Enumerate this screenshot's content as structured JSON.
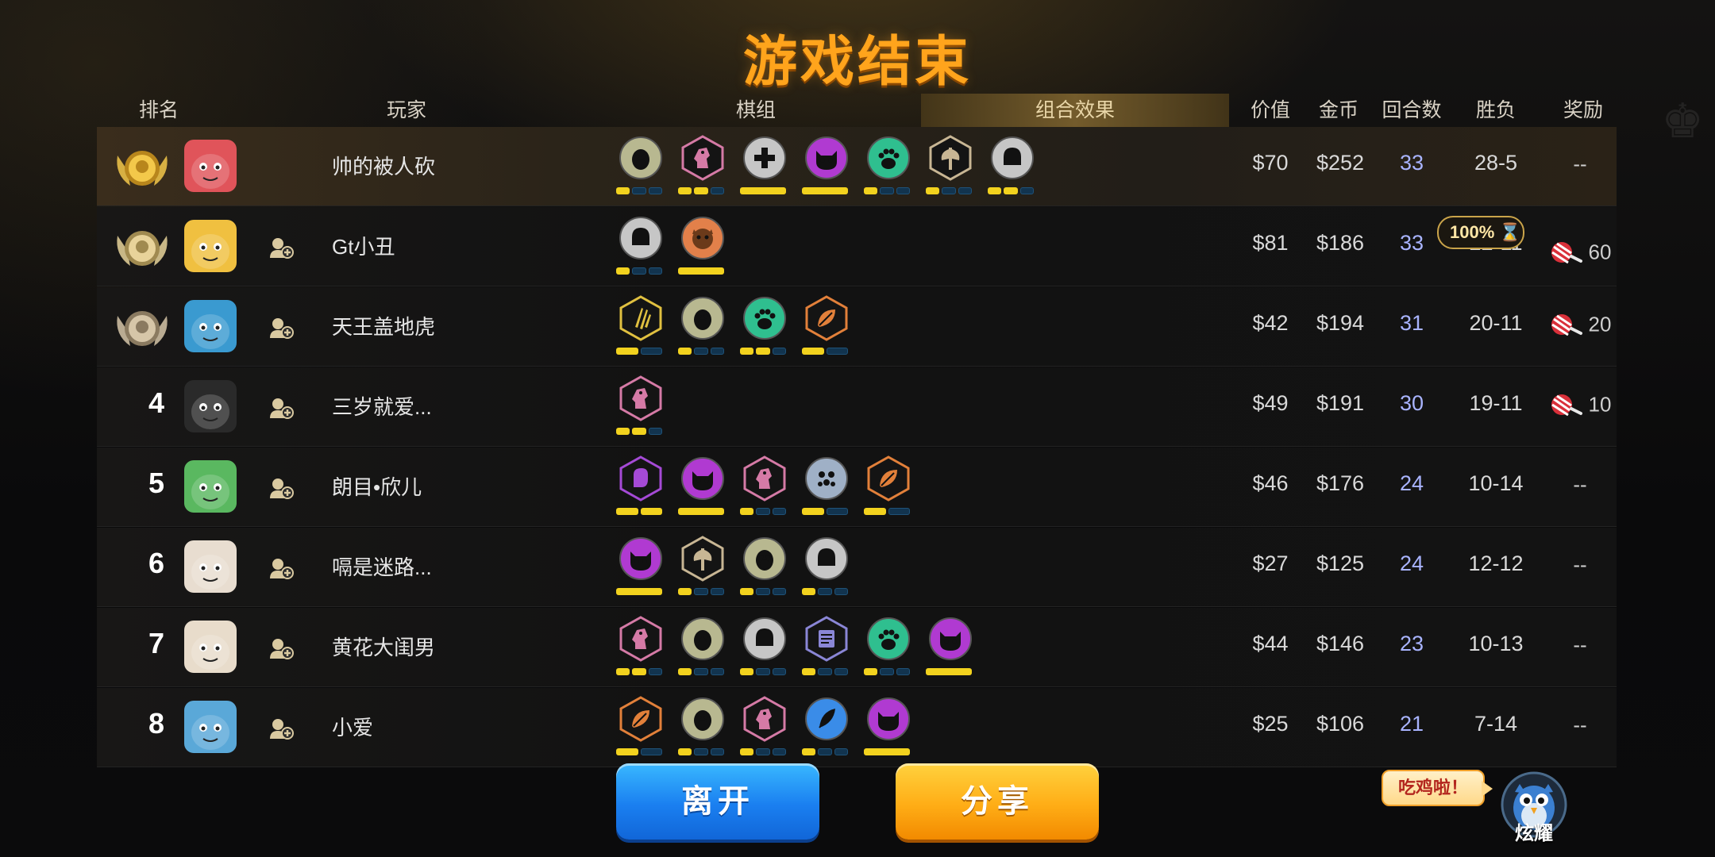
{
  "title": "游戏结束",
  "columns": {
    "rank": "排名",
    "player": "玩家",
    "lineup": "棋组",
    "combo": "组合效果",
    "value": "价值",
    "gold": "金币",
    "rounds": "回合数",
    "record": "胜负",
    "reward": "奖励"
  },
  "reward_badge": "100%",
  "players": [
    {
      "rank": "1",
      "name": "帅的被人砍",
      "value": "$70",
      "gold": "$252",
      "rounds": "33",
      "record": "28-5",
      "reward": "--",
      "add_friend": false
    },
    {
      "rank": "2",
      "name": "Gt小丑",
      "value": "$81",
      "gold": "$186",
      "rounds": "33",
      "record": "22-11",
      "reward": "60",
      "add_friend": true
    },
    {
      "rank": "3",
      "name": "天王盖地虎",
      "value": "$42",
      "gold": "$194",
      "rounds": "31",
      "record": "20-11",
      "reward": "20",
      "add_friend": true
    },
    {
      "rank": "4",
      "name": "三岁就爱...",
      "value": "$49",
      "gold": "$191",
      "rounds": "30",
      "record": "19-11",
      "reward": "10",
      "add_friend": true
    },
    {
      "rank": "5",
      "name": "朗目•欣儿",
      "value": "$46",
      "gold": "$176",
      "rounds": "24",
      "record": "10-14",
      "reward": "--",
      "add_friend": true
    },
    {
      "rank": "6",
      "name": "嗝是迷路...",
      "value": "$27",
      "gold": "$125",
      "rounds": "24",
      "record": "12-12",
      "reward": "--",
      "add_friend": true
    },
    {
      "rank": "7",
      "name": "黄花大闺男",
      "value": "$44",
      "gold": "$146",
      "rounds": "23",
      "record": "10-13",
      "reward": "--",
      "add_friend": true
    },
    {
      "rank": "8",
      "name": "小爱",
      "value": "$25",
      "gold": "$106",
      "rounds": "21",
      "record": "7-14",
      "reward": "--",
      "add_friend": true
    }
  ],
  "synergies": [
    [
      {
        "icon": "penguin-icon",
        "shape": "circle",
        "color": "#b8b890",
        "bars": [
          1,
          0,
          0
        ]
      },
      {
        "icon": "knight-icon",
        "shape": "hex",
        "color": "#d57aa6",
        "bars": [
          1,
          1,
          0
        ]
      },
      {
        "icon": "cross-icon",
        "shape": "circle",
        "color": "#c6c6c6",
        "bars": [
          2
        ]
      },
      {
        "icon": "demon-icon",
        "shape": "circle",
        "color": "#b03ad1",
        "bars": [
          2
        ]
      },
      {
        "icon": "paw-icon",
        "shape": "circle",
        "color": "#2fbf8f",
        "bars": [
          1,
          0,
          0
        ]
      },
      {
        "icon": "axe-icon",
        "shape": "hex",
        "color": "#c8b694",
        "bars": [
          1,
          0,
          0
        ]
      },
      {
        "icon": "helmet-icon",
        "shape": "circle",
        "color": "#c6c6c6",
        "bars": [
          1,
          1,
          0
        ]
      }
    ],
    [
      {
        "icon": "helmet-icon",
        "shape": "circle",
        "color": "#c6c6c6",
        "bars": [
          1,
          0,
          0
        ]
      },
      {
        "icon": "ogre-icon",
        "shape": "circle",
        "color": "#e2804a",
        "bars": [
          2
        ]
      }
    ],
    [
      {
        "icon": "claw-icon",
        "shape": "hex",
        "color": "#e0c040",
        "bars": [
          1,
          0
        ]
      },
      {
        "icon": "penguin-icon",
        "shape": "circle",
        "color": "#b8b890",
        "bars": [
          1,
          0,
          0
        ]
      },
      {
        "icon": "paw-icon",
        "shape": "circle",
        "color": "#2fbf8f",
        "bars": [
          1,
          1,
          0
        ]
      },
      {
        "icon": "leaf-icon",
        "shape": "hex",
        "color": "#e2803a",
        "bars": [
          1,
          0
        ]
      }
    ],
    [
      {
        "icon": "knight-icon",
        "shape": "hex",
        "color": "#d57aa6",
        "bars": [
          1,
          1,
          0
        ]
      }
    ],
    [
      {
        "icon": "fist-icon",
        "shape": "hex",
        "color": "#a54ad6",
        "bars": [
          1,
          1
        ]
      },
      {
        "icon": "demon-icon",
        "shape": "circle",
        "color": "#b03ad1",
        "bars": [
          2
        ]
      },
      {
        "icon": "knight-icon",
        "shape": "hex",
        "color": "#d57aa6",
        "bars": [
          1,
          0,
          0
        ]
      },
      {
        "icon": "dots-icon",
        "shape": "circle",
        "color": "#9fb0c6",
        "bars": [
          1,
          0
        ]
      },
      {
        "icon": "leaf-icon",
        "shape": "hex",
        "color": "#e2803a",
        "bars": [
          1,
          0
        ]
      }
    ],
    [
      {
        "icon": "demon-icon",
        "shape": "circle",
        "color": "#b03ad1",
        "bars": [
          2
        ]
      },
      {
        "icon": "axe-icon",
        "shape": "hex",
        "color": "#c8b694",
        "bars": [
          1,
          0,
          0
        ]
      },
      {
        "icon": "penguin-icon",
        "shape": "circle",
        "color": "#b8b890",
        "bars": [
          1,
          0,
          0
        ]
      },
      {
        "icon": "helmet-icon",
        "shape": "circle",
        "color": "#c6c6c6",
        "bars": [
          1,
          0,
          0
        ]
      }
    ],
    [
      {
        "icon": "knight-icon",
        "shape": "hex",
        "color": "#d57aa6",
        "bars": [
          1,
          1,
          0
        ]
      },
      {
        "icon": "penguin-icon",
        "shape": "circle",
        "color": "#b8b890",
        "bars": [
          1,
          0,
          0
        ]
      },
      {
        "icon": "helmet-icon",
        "shape": "circle",
        "color": "#c6c6c6",
        "bars": [
          1,
          0,
          0
        ]
      },
      {
        "icon": "scroll-icon",
        "shape": "hex",
        "color": "#8a86d6",
        "bars": [
          1,
          0,
          0
        ]
      },
      {
        "icon": "paw-icon",
        "shape": "circle",
        "color": "#2fbf8f",
        "bars": [
          1,
          0,
          0
        ]
      },
      {
        "icon": "demon-icon",
        "shape": "circle",
        "color": "#b03ad1",
        "bars": [
          2
        ]
      }
    ],
    [
      {
        "icon": "leaf-icon",
        "shape": "hex",
        "color": "#e2803a",
        "bars": [
          1,
          0
        ]
      },
      {
        "icon": "penguin-icon",
        "shape": "circle",
        "color": "#b8b890",
        "bars": [
          1,
          0,
          0
        ]
      },
      {
        "icon": "knight-icon",
        "shape": "hex",
        "color": "#d57aa6",
        "bars": [
          1,
          0,
          0
        ]
      },
      {
        "icon": "feather-icon",
        "shape": "circle",
        "color": "#3a8ce8",
        "bars": [
          1,
          0,
          0
        ]
      },
      {
        "icon": "demon-icon",
        "shape": "circle",
        "color": "#b03ad1",
        "bars": [
          2
        ]
      }
    ]
  ],
  "avatar_colors": [
    "#e0545a",
    "#f0c040",
    "#3a9ad0",
    "#2a2a2a",
    "#5ab860",
    "#e8ddd0",
    "#e8dccb",
    "#5aa8d8"
  ],
  "buttons": {
    "leave": "离开",
    "share": "分享"
  },
  "chicken_bubble": "吃鸡啦！",
  "flaunt_label": "炫耀",
  "colors": {
    "title": "#ffa41c",
    "bar_on": "#f2d21e",
    "bar_off": "#12344f",
    "rounds": "#a9b4ff"
  }
}
